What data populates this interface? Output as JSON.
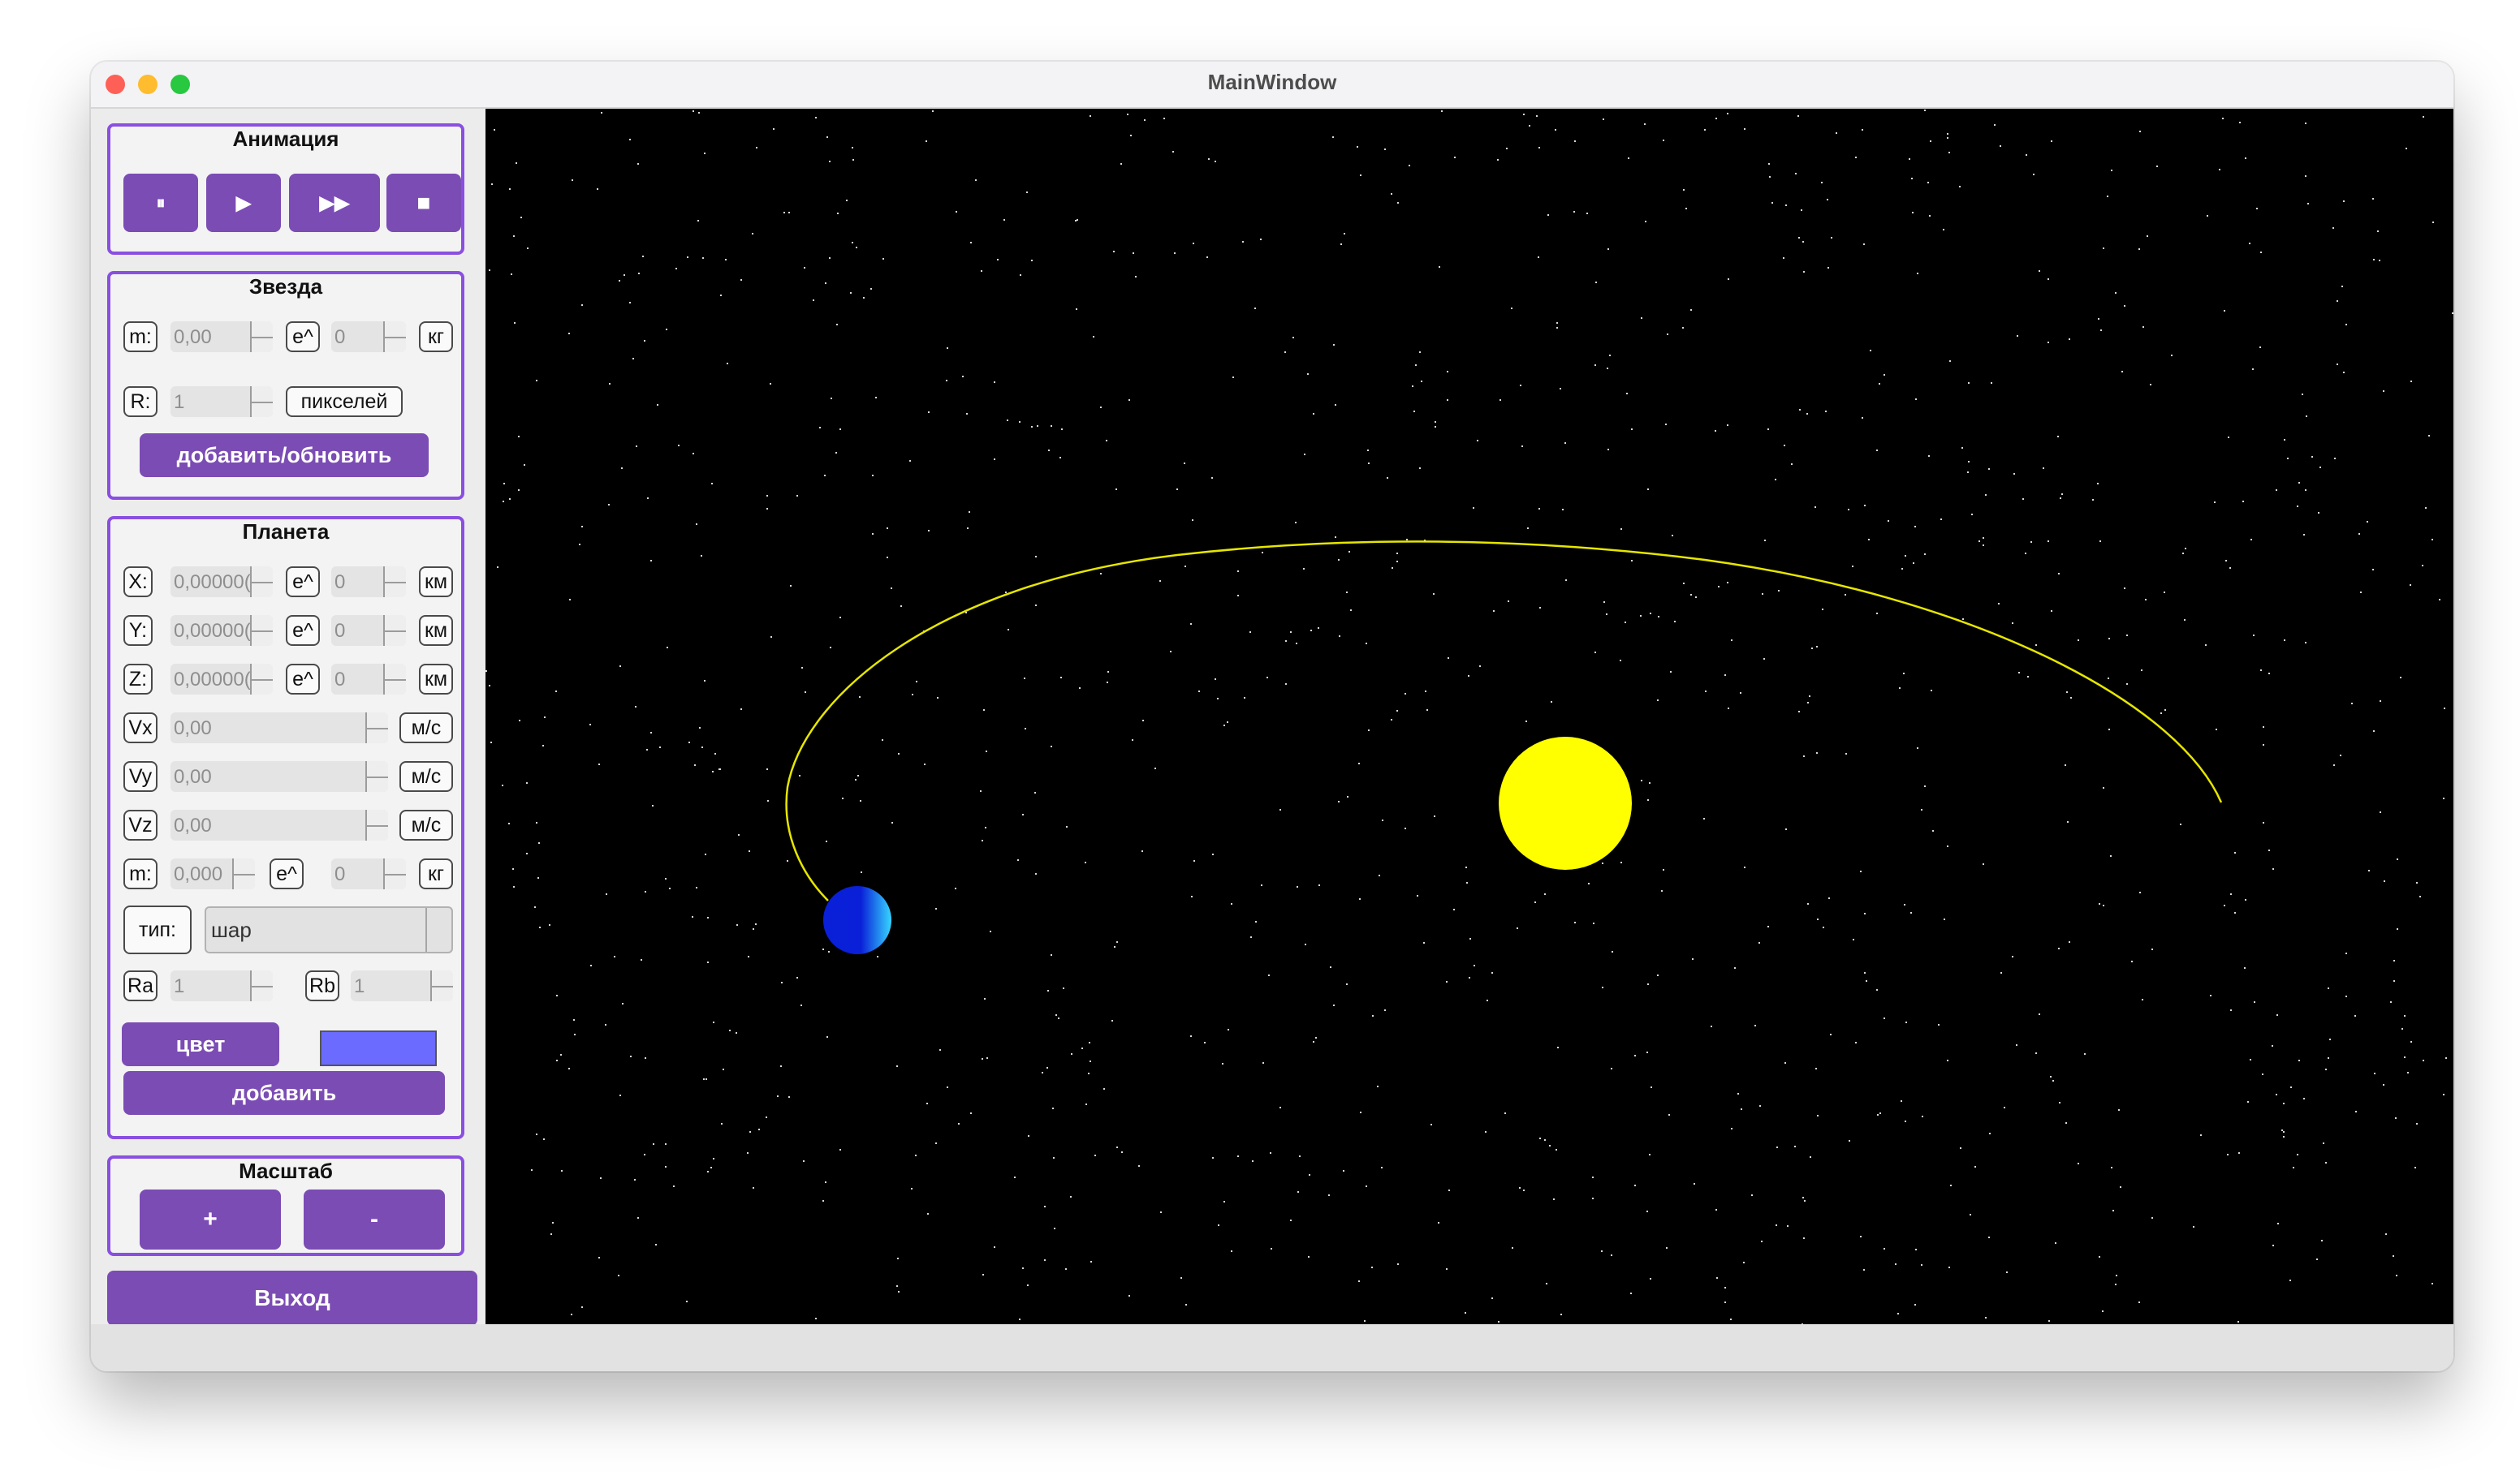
{
  "window": {
    "title": "MainWindow"
  },
  "animation": {
    "title": "Анимация",
    "buttons": [
      {
        "name": "pause",
        "glyph": "⏸"
      },
      {
        "name": "play",
        "glyph": "▶"
      },
      {
        "name": "fast-forward",
        "glyph": "▶▶"
      },
      {
        "name": "stop",
        "glyph": "■"
      }
    ]
  },
  "star": {
    "title": "Звезда",
    "mass_label": "m:",
    "mass_value": "0,00",
    "exp_label": "e^",
    "exp_value": "0",
    "mass_unit": "кг",
    "radius_label": "R:",
    "radius_value": "1",
    "radius_unit": "пикселей",
    "add_update_label": "добавить/обновить"
  },
  "planet": {
    "title": "Планета",
    "x_label": "X:",
    "x_value": "0,00000(",
    "x_exp_label": "e^",
    "x_exp_value": "0",
    "x_unit": "км",
    "y_label": "Y:",
    "y_value": "0,00000(",
    "y_exp_label": "e^",
    "y_exp_value": "0",
    "y_unit": "км",
    "z_label": "Z:",
    "z_value": "0,00000(",
    "z_exp_label": "e^",
    "z_exp_value": "0",
    "z_unit": "км",
    "vx_label": "Vx",
    "vx_value": "0,00",
    "vx_unit": "м/с",
    "vy_label": "Vy",
    "vy_value": "0,00",
    "vy_unit": "м/с",
    "vz_label": "Vz",
    "vz_value": "0,00",
    "vz_unit": "м/с",
    "m_label": "m:",
    "m_value": "0,000",
    "m_exp_label": "e^",
    "m_exp_value": "0",
    "m_unit": "кг",
    "type_label": "тип:",
    "type_value": "шар",
    "ra_label": "Ra",
    "ra_value": "1",
    "rb_label": "Rb",
    "rb_value": "1",
    "color_label": "цвет",
    "color_value": "#6b6bff",
    "add_label": "добавить"
  },
  "scale": {
    "title": "Масштаб",
    "plus_label": "+",
    "minus_label": "-"
  },
  "exit_label": "Выход",
  "colors": {
    "accent": "#7b4cb4",
    "group_border": "#8a4fe0",
    "space": "#000000",
    "star": "#ffff00",
    "orbit": "#e6e600",
    "planet_light": "#36d6ff",
    "planet_dark": "#0a1fd8"
  }
}
